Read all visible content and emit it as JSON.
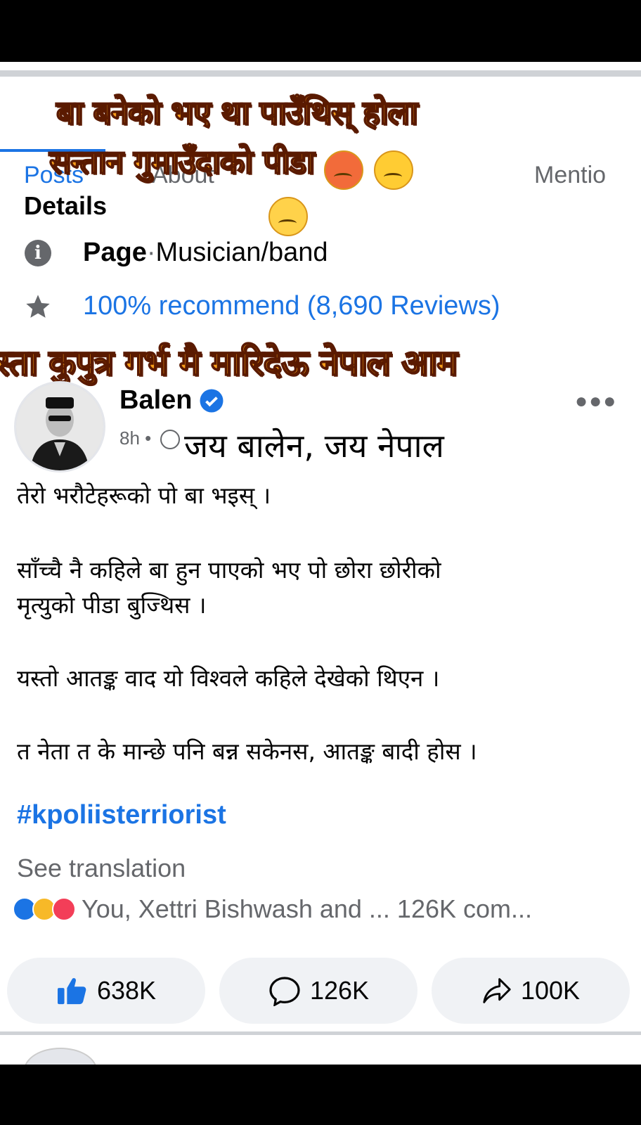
{
  "tabs": {
    "posts": "Posts",
    "about": "About",
    "mentions": "Mentio"
  },
  "overlay": {
    "line1": "बा बनेको भए था पाउँथिस् होला",
    "line2": "सन्तान गुमाउँदाको पीडा",
    "banner": "स्ता कुपुत्र गर्भ मै मारिदेऊ नेपाल आम"
  },
  "details": {
    "title": "Details",
    "page_label": "Page",
    "page_sep": " · ",
    "page_category": "Musician/band",
    "recommend": "100% recommend (8,690 Reviews)"
  },
  "post": {
    "author": "Balen",
    "time": "8h",
    "time_sep": " •",
    "caption_overlay": "जय बालेन, जय नेपाल",
    "lines": [
      "तेरो भरौटेहरूको पो बा भइस् ।",
      "साँच्चै नै कहिले बा हुन पाएको  भए पो छोरा छोरीको",
      "मृत्युको पीडा बुज्थिस ।",
      "यस्तो आतङ्क वाद यो विश्वले कहिले देखेको थिएन ।",
      "त नेता त के मान्छे पनि बन्न सकेनस, आतङ्क बादी होस ।"
    ],
    "hashtag": "#kpoliisterriorist",
    "see_translation": "See translation",
    "reactions_text": "You, Xettri Bishwash and ... 126K com..."
  },
  "actions": {
    "like_count": "638K",
    "comment_count": "126K",
    "share_count": "100K"
  },
  "colors": {
    "accent": "#1b74e4",
    "overlay_fill": "#f59c1a"
  },
  "icons": [
    "info-icon",
    "star-icon",
    "verified-badge-icon",
    "more-options-icon",
    "globe-icon",
    "like-icon",
    "comment-icon",
    "share-icon"
  ]
}
